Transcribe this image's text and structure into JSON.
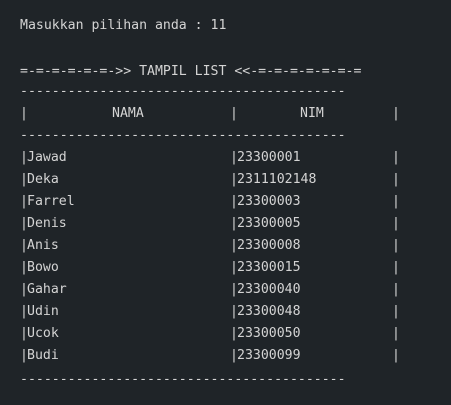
{
  "terminal": {
    "prompt": "Masukkan pilihan anda : 11",
    "banner": "=-=-=-=-=-=->> TAMPIL LIST <<-=-=-=-=-=-=-=",
    "separator": "-----------------------------------------",
    "header": {
      "left_bar": "|",
      "col_name": "NAMA",
      "mid_bar": "|",
      "col_nim": "NIM",
      "right_bar": "|"
    },
    "rows": [
      {
        "name": "Jawad",
        "nim": "23300001"
      },
      {
        "name": "Deka",
        "nim": "2311102148"
      },
      {
        "name": "Farrel",
        "nim": "23300003"
      },
      {
        "name": "Denis",
        "nim": "23300005"
      },
      {
        "name": "Anis",
        "nim": "23300008"
      },
      {
        "name": "Bowo",
        "nim": "23300015"
      },
      {
        "name": "Gahar",
        "nim": "23300040"
      },
      {
        "name": "Udin",
        "nim": "23300048"
      },
      {
        "name": "Ucok",
        "nim": "23300050"
      },
      {
        "name": "Budi",
        "nim": "23300099"
      }
    ],
    "bar_char": "|"
  }
}
